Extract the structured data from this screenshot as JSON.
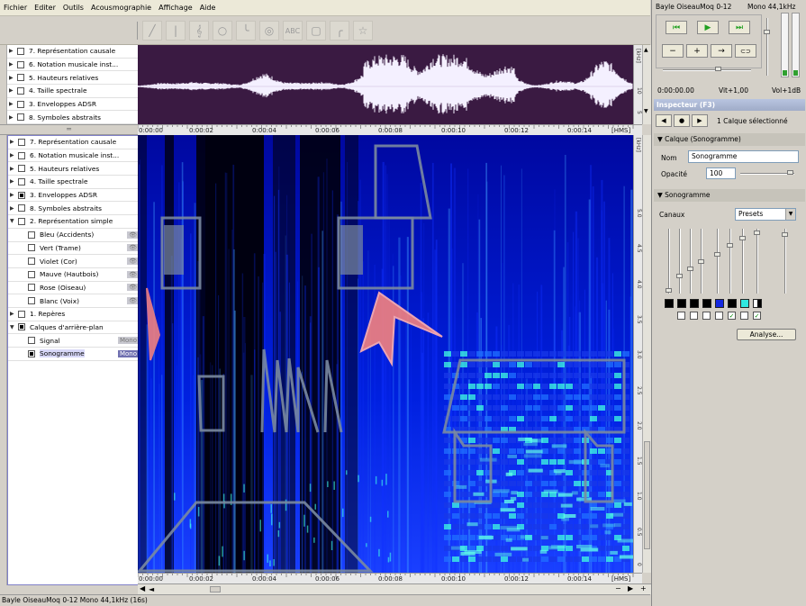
{
  "menu": [
    "Fichier",
    "Editer",
    "Outils",
    "Acousmographie",
    "Affichage",
    "Aide"
  ],
  "toolbar_icons": [
    "line-tool-icon",
    "bar-tool-icon",
    "clef-tool-icon",
    "circle-tool-icon",
    "curve-tool-icon",
    "spiral-tool-icon",
    "text-tool-icon",
    "rect-tool-icon",
    "arc-tool-icon",
    "star-tool-icon"
  ],
  "toolbar_glyphs": [
    "╱",
    "|",
    "𝄞",
    "○",
    "╰",
    "◎",
    "ABC",
    "▢",
    "╭",
    "☆"
  ],
  "top_layers": [
    {
      "label": "7. Représentation causale"
    },
    {
      "label": "6. Notation musicale inst..."
    },
    {
      "label": "5. Hauteurs relatives"
    },
    {
      "label": "4. Taille spectrale"
    },
    {
      "label": "3. Enveloppes ADSR"
    },
    {
      "label": "8. Symboles abstraits"
    }
  ],
  "bottom_layers": [
    {
      "label": "7. Représentation causale",
      "type": "group",
      "checked": false
    },
    {
      "label": "6. Notation musicale inst...",
      "type": "group",
      "checked": false
    },
    {
      "label": "5. Hauteurs relatives",
      "type": "group",
      "checked": false
    },
    {
      "label": "4. Taille spectrale",
      "type": "group",
      "checked": false
    },
    {
      "label": "3. Enveloppes ADSR",
      "type": "group",
      "checked": true
    },
    {
      "label": "8. Symboles abstraits",
      "type": "group",
      "checked": false
    },
    {
      "label": "2. Représentation simple",
      "type": "open",
      "checked": false
    },
    {
      "label": "Bleu (Accidents)",
      "type": "sub",
      "checked": false,
      "badge": "👁"
    },
    {
      "label": "Vert (Trame)",
      "type": "sub",
      "checked": false,
      "badge": "👁"
    },
    {
      "label": "Violet (Cor)",
      "type": "sub",
      "checked": false,
      "badge": "👁"
    },
    {
      "label": "Mauve (Hautbois)",
      "type": "sub",
      "checked": false,
      "badge": "👁"
    },
    {
      "label": "Rose (Oiseau)",
      "type": "sub",
      "checked": false,
      "badge": "👁"
    },
    {
      "label": "Blanc (Voix)",
      "type": "sub",
      "checked": false,
      "badge": "👁"
    },
    {
      "label": "1. Repères",
      "type": "group",
      "checked": false
    },
    {
      "label": "Calques d'arrière-plan",
      "type": "open",
      "checked": true
    },
    {
      "label": "Signal",
      "type": "sub",
      "checked": false,
      "badge": "Mono"
    },
    {
      "label": "Sonogramme",
      "type": "sub",
      "checked": true,
      "badge": "Mono",
      "selected": true
    }
  ],
  "time_labels": [
    "0:00:00",
    "0:00:02",
    "0:00:04",
    "0:00:06",
    "0:00:08",
    "0:00:10",
    "0:00:12",
    "0:00:14"
  ],
  "time_unit": "[HMS]",
  "wave_axis": {
    "unit": "[kHz]",
    "labels": [
      "10",
      "5"
    ]
  },
  "freq_axis": {
    "unit": "[kHz]",
    "labels": [
      "5.0",
      "4.5",
      "4.0",
      "3.5",
      "3.0",
      "2.5",
      "2.0",
      "1.5",
      "1.0",
      "0.5",
      "0"
    ]
  },
  "status": "Bayle OiseauMoq 0-12 Mono 44,1kHz (16s)",
  "right": {
    "file_title": "Bayle OiseauMoq 0-12",
    "file_format": "Mono 44,1kHz",
    "transport": {
      "prev": "⏮",
      "play": "▶",
      "next": "⏭",
      "minus": "−",
      "plus": "+",
      "arrow": "→",
      "loop": "⊂⊃"
    },
    "time": "0:00:00.00",
    "speed": "Vit+1,00",
    "volume": "Vol+1dB",
    "inspector_title": "Inspecteur (F3)",
    "selection": "1 Calque sélectionné",
    "calque_section": "Calque (Sonogramme)",
    "nom_label": "Nom",
    "nom_value": "Sonogramme",
    "opacite_label": "Opacité",
    "opacite_value": "100",
    "sonogramme_section": "Sonogramme",
    "canaux_label": "Canaux",
    "presets_value": "Presets",
    "analyse_button": "Analyse..."
  },
  "colors": {
    "wave_bg": "#3a1a42",
    "spectro_dark": "#000030",
    "spectro_blue": "#1a2cff",
    "overlay_gray": "#7a8aa0",
    "overlay_pink": "#f08080",
    "play_green": "#20a020"
  }
}
